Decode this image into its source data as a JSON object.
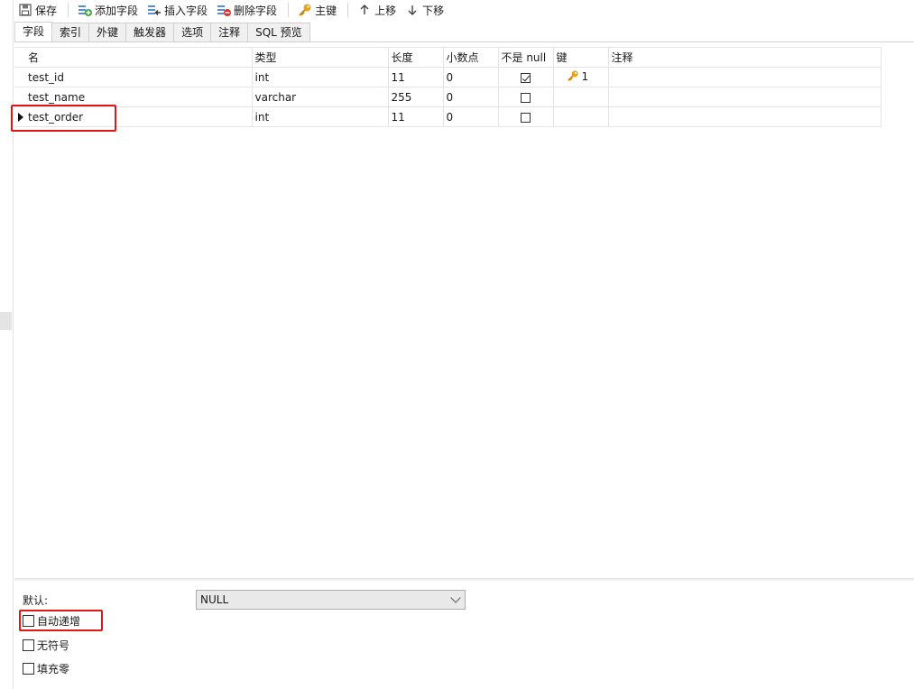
{
  "toolbar": {
    "save": "保存",
    "add_field": "添加字段",
    "insert_field": "插入字段",
    "delete_field": "删除字段",
    "primary_key": "主键",
    "move_up": "上移",
    "move_down": "下移"
  },
  "tabs": [
    "字段",
    "索引",
    "外键",
    "触发器",
    "选项",
    "注释",
    "SQL 预览"
  ],
  "columns": [
    "名",
    "类型",
    "长度",
    "小数点",
    "不是 null",
    "键",
    "注释"
  ],
  "rows": [
    {
      "name": "test_id",
      "type": "int",
      "length": "11",
      "decimals": "0",
      "not_null": true,
      "key": "1",
      "comment": ""
    },
    {
      "name": "test_name",
      "type": "varchar",
      "length": "255",
      "decimals": "0",
      "not_null": false,
      "key": "",
      "comment": ""
    },
    {
      "name": "test_order",
      "type": "int",
      "length": "11",
      "decimals": "0",
      "not_null": false,
      "key": "",
      "comment": ""
    }
  ],
  "properties": {
    "default_label": "默认:",
    "default_value": "NULL",
    "auto_increment": "自动递增",
    "unsigned": "无符号",
    "zerofill": "填充零"
  },
  "colors": {
    "highlight": "#e01515",
    "key_icon": "#e8a317"
  }
}
